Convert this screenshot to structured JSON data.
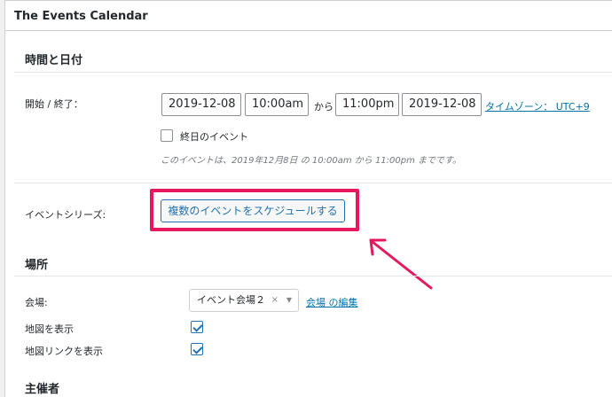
{
  "panel": {
    "title": "The Events Calendar"
  },
  "datetime": {
    "section_title": "時間と日付",
    "label": "開始 / 終了：",
    "start_date": "2019-12-08",
    "start_time": "10:00am",
    "separator": "から",
    "end_time": "11:00pm",
    "end_date": "2019-12-08",
    "timezone_link": "タイムゾーン： UTC+9",
    "allday_label": "終日のイベント",
    "allday_checked": false,
    "summary": "このイベントは、2019年12月8日 の 10:00am から 11:00pm までです。"
  },
  "series": {
    "label": "イベントシリーズ:",
    "button": "複数のイベントをスケジュールする"
  },
  "venue": {
    "section_title": "場所",
    "venue_label": "会場:",
    "venue_value": "イベント会場２",
    "venue_clear": "×",
    "venue_arrow": "▼",
    "edit_link": "会場 の編集",
    "show_map_label": "地図を表示",
    "show_map_checked": true,
    "show_map_link_label": "地図リンクを表示",
    "show_map_link_checked": true
  },
  "organizer": {
    "section_title": "主催者"
  },
  "colors": {
    "highlight": "#e5175e",
    "link": "#0073aa",
    "arrow": "#e5175e"
  }
}
